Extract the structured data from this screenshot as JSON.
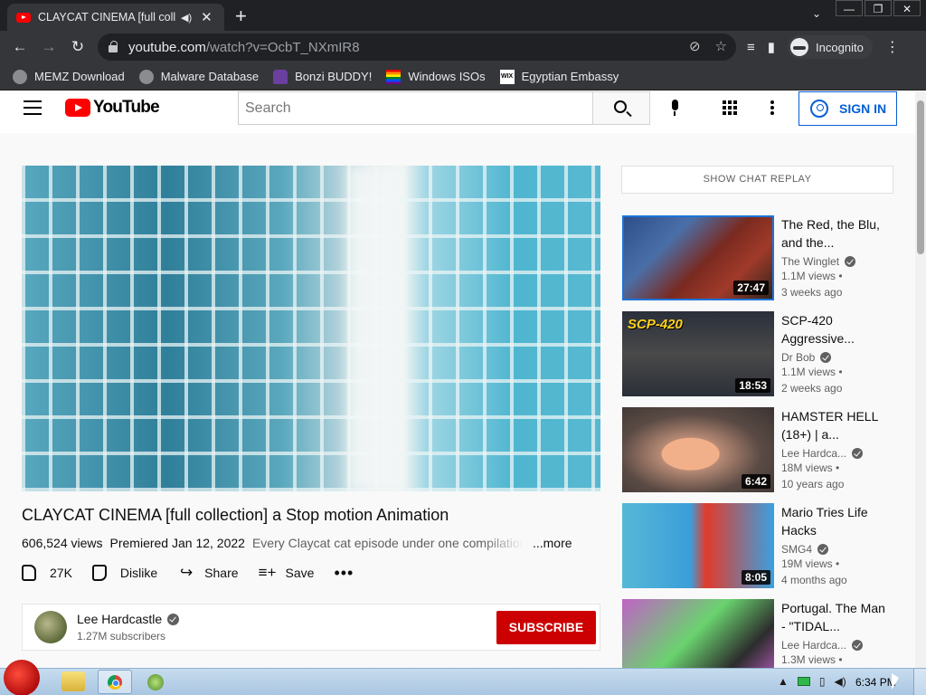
{
  "browser": {
    "tab_title": "CLAYCAT CINEMA [full collection] a Stop motion Animation",
    "url_host": "youtube.com",
    "url_path": "/watch?v=OcbT_NXmIR8",
    "profile_label": "Incognito"
  },
  "bookmarks": [
    {
      "label": "MEMZ Download",
      "icon": "globe-icon"
    },
    {
      "label": "Malware Database",
      "icon": "globe-icon"
    },
    {
      "label": "Bonzi BUDDY!",
      "icon": "bonzi-icon"
    },
    {
      "label": "Windows ISOs",
      "icon": "rainbow-flag-icon"
    },
    {
      "label": "Egyptian Embassy",
      "icon": "wix-icon"
    }
  ],
  "youtube": {
    "logo_text": "YouTube",
    "search_placeholder": "Search",
    "sign_in": "SIGN IN"
  },
  "video": {
    "title": "CLAYCAT CINEMA [full collection] a Stop motion Animation",
    "views": "606,524 views",
    "premiered": "Premiered Jan 12, 2022",
    "description": "Every Claycat cat episode under one compilation",
    "more": "...more",
    "likes": "27K",
    "dislike": "Dislike",
    "share": "Share",
    "save": "Save"
  },
  "channel": {
    "name": "Lee Hardcastle",
    "subscribers": "1.27M subscribers",
    "subscribe": "SUBSCRIBE"
  },
  "sidebar": {
    "chat_replay": "SHOW CHAT REPLAY",
    "recommendations": [
      {
        "title": "The Red, the Blu, and the...",
        "channel": "The Winglet",
        "views": "1.1M views •",
        "age": "3 weeks ago",
        "duration": "27:47"
      },
      {
        "title": "SCP-420 Aggressive...",
        "channel": "Dr Bob",
        "views": "1.1M views •",
        "age": "2 weeks ago",
        "duration": "18:53",
        "thumb_text": "SCP-420"
      },
      {
        "title": "HAMSTER HELL (18+) | a...",
        "channel": "Lee Hardca...",
        "views": "18M views •",
        "age": "10 years ago",
        "duration": "6:42"
      },
      {
        "title": "Mario Tries Life Hacks",
        "channel": "SMG4",
        "views": "19M views •",
        "age": "4 months ago",
        "duration": "8:05"
      },
      {
        "title": "Portugal. The Man - \"TIDAL...",
        "channel": "Lee Hardca...",
        "views": "1.3M views •",
        "age": "",
        "duration": ""
      }
    ]
  },
  "taskbar": {
    "clock": "6:34 PM"
  }
}
